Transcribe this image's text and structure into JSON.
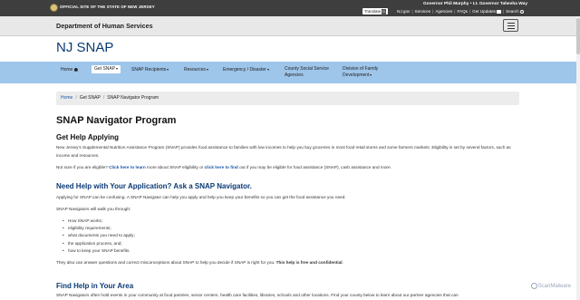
{
  "topbar": {
    "official_label": "OFFICIAL SITE OF THE STATE OF NEW JERSEY",
    "governor_line": "Governor Phil Murphy • Lt. Governor Tahesha Way",
    "translate_label": "Translate",
    "translate_badge": "G",
    "links": [
      "NJ.gov",
      "Services",
      "Agencies",
      "FAQs",
      "Get Updates",
      "Search"
    ]
  },
  "department": {
    "title": "Department of Human Services"
  },
  "site": {
    "title": "NJ SNAP"
  },
  "nav": {
    "items": [
      {
        "label": "Home"
      },
      {
        "label": "Get SNAP"
      },
      {
        "label": "SNAP Recipients"
      },
      {
        "label": "Resources"
      },
      {
        "label": "Emergency / Disaster"
      },
      {
        "label_line1": "County Social Service",
        "label_line2": "Agencies"
      },
      {
        "label_line1": "Division of Family",
        "label_line2": "Development"
      }
    ]
  },
  "breadcrumb": {
    "home": "Home",
    "section": "Get SNAP",
    "current": "SNAP Navigator Program"
  },
  "main": {
    "page_title": "SNAP Navigator Program",
    "section1_title": "Get Help Applying",
    "section1_p1": "New Jersey's Supplemental Nutrition Assistance Program (SNAP) provides food assistance to families with low incomes to help you buy groceries in most food retail stores and some farmers markets. Eligibility is set by several factors, such as income and resources.",
    "section1_p2_a": "Not sure if you are eligible? ",
    "section1_p2_link1": "Click here to learn",
    "section1_p2_b": " more about SNAP eligibility or ",
    "section1_p2_link2": "click here to find",
    "section1_p2_c": " out if you may be eligible for food assistance (SNAP), cash assistance and more.",
    "section2_title": "Need Help with Your Application? Ask a SNAP Navigator.",
    "section2_p1": "Applying for SNAP can be confusing. A SNAP Navigator can help you apply and help you keep your benefits so you can get the food assistance you need.",
    "section2_p2": "SNAP Navigators will walk you through:",
    "section2_list": [
      "How SNAP works;",
      "eligibility requirements;",
      "what documents you need to apply;",
      "the application process, and;",
      "how to keep your SNAP benefits."
    ],
    "section2_p3_a": "They also can answer questions and correct misconceptions about SNAP to help you decide if SNAP is right for you. ",
    "section2_p3_bold": "This help is free and confidential",
    "section2_p3_end": ".",
    "section3_title": "Find Help in Your Area",
    "section3_p1": "SNAP Navigators often hold events in your community at food pantries, senior centers, health care facilities, libraries, schools and other locations.   Find your county below to learn about our partner agencies that can"
  },
  "watermark": {
    "text": "ScanMalware"
  }
}
